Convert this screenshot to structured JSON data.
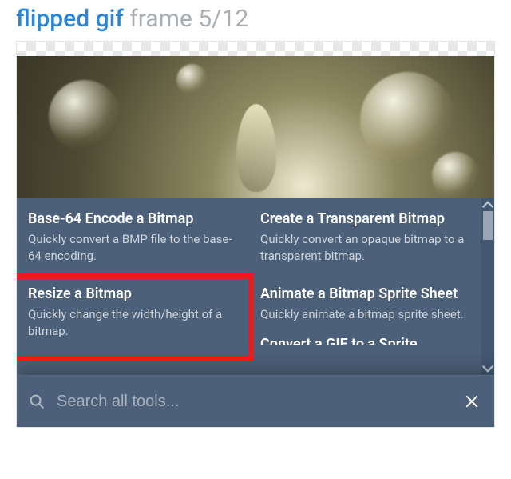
{
  "header": {
    "title_main": "flipped gif",
    "title_sub": "frame 5/12"
  },
  "tools": {
    "left": [
      {
        "title": "Base-64 Encode a Bitmap",
        "desc": "Quickly convert a BMP file to the base-64 encoding."
      },
      {
        "title": "Resize a Bitmap",
        "desc": "Quickly change the width/height of a bitmap."
      }
    ],
    "right": [
      {
        "title": "Create a Transparent Bitmap",
        "desc": "Quickly convert an opaque bitmap to a transparent bitmap."
      },
      {
        "title": "Animate a Bitmap Sprite Sheet",
        "desc": "Quickly animate a bitmap sprite sheet."
      }
    ],
    "partial_next": "Convert a GIF to a Sprite"
  },
  "search": {
    "placeholder": "Search all tools..."
  }
}
